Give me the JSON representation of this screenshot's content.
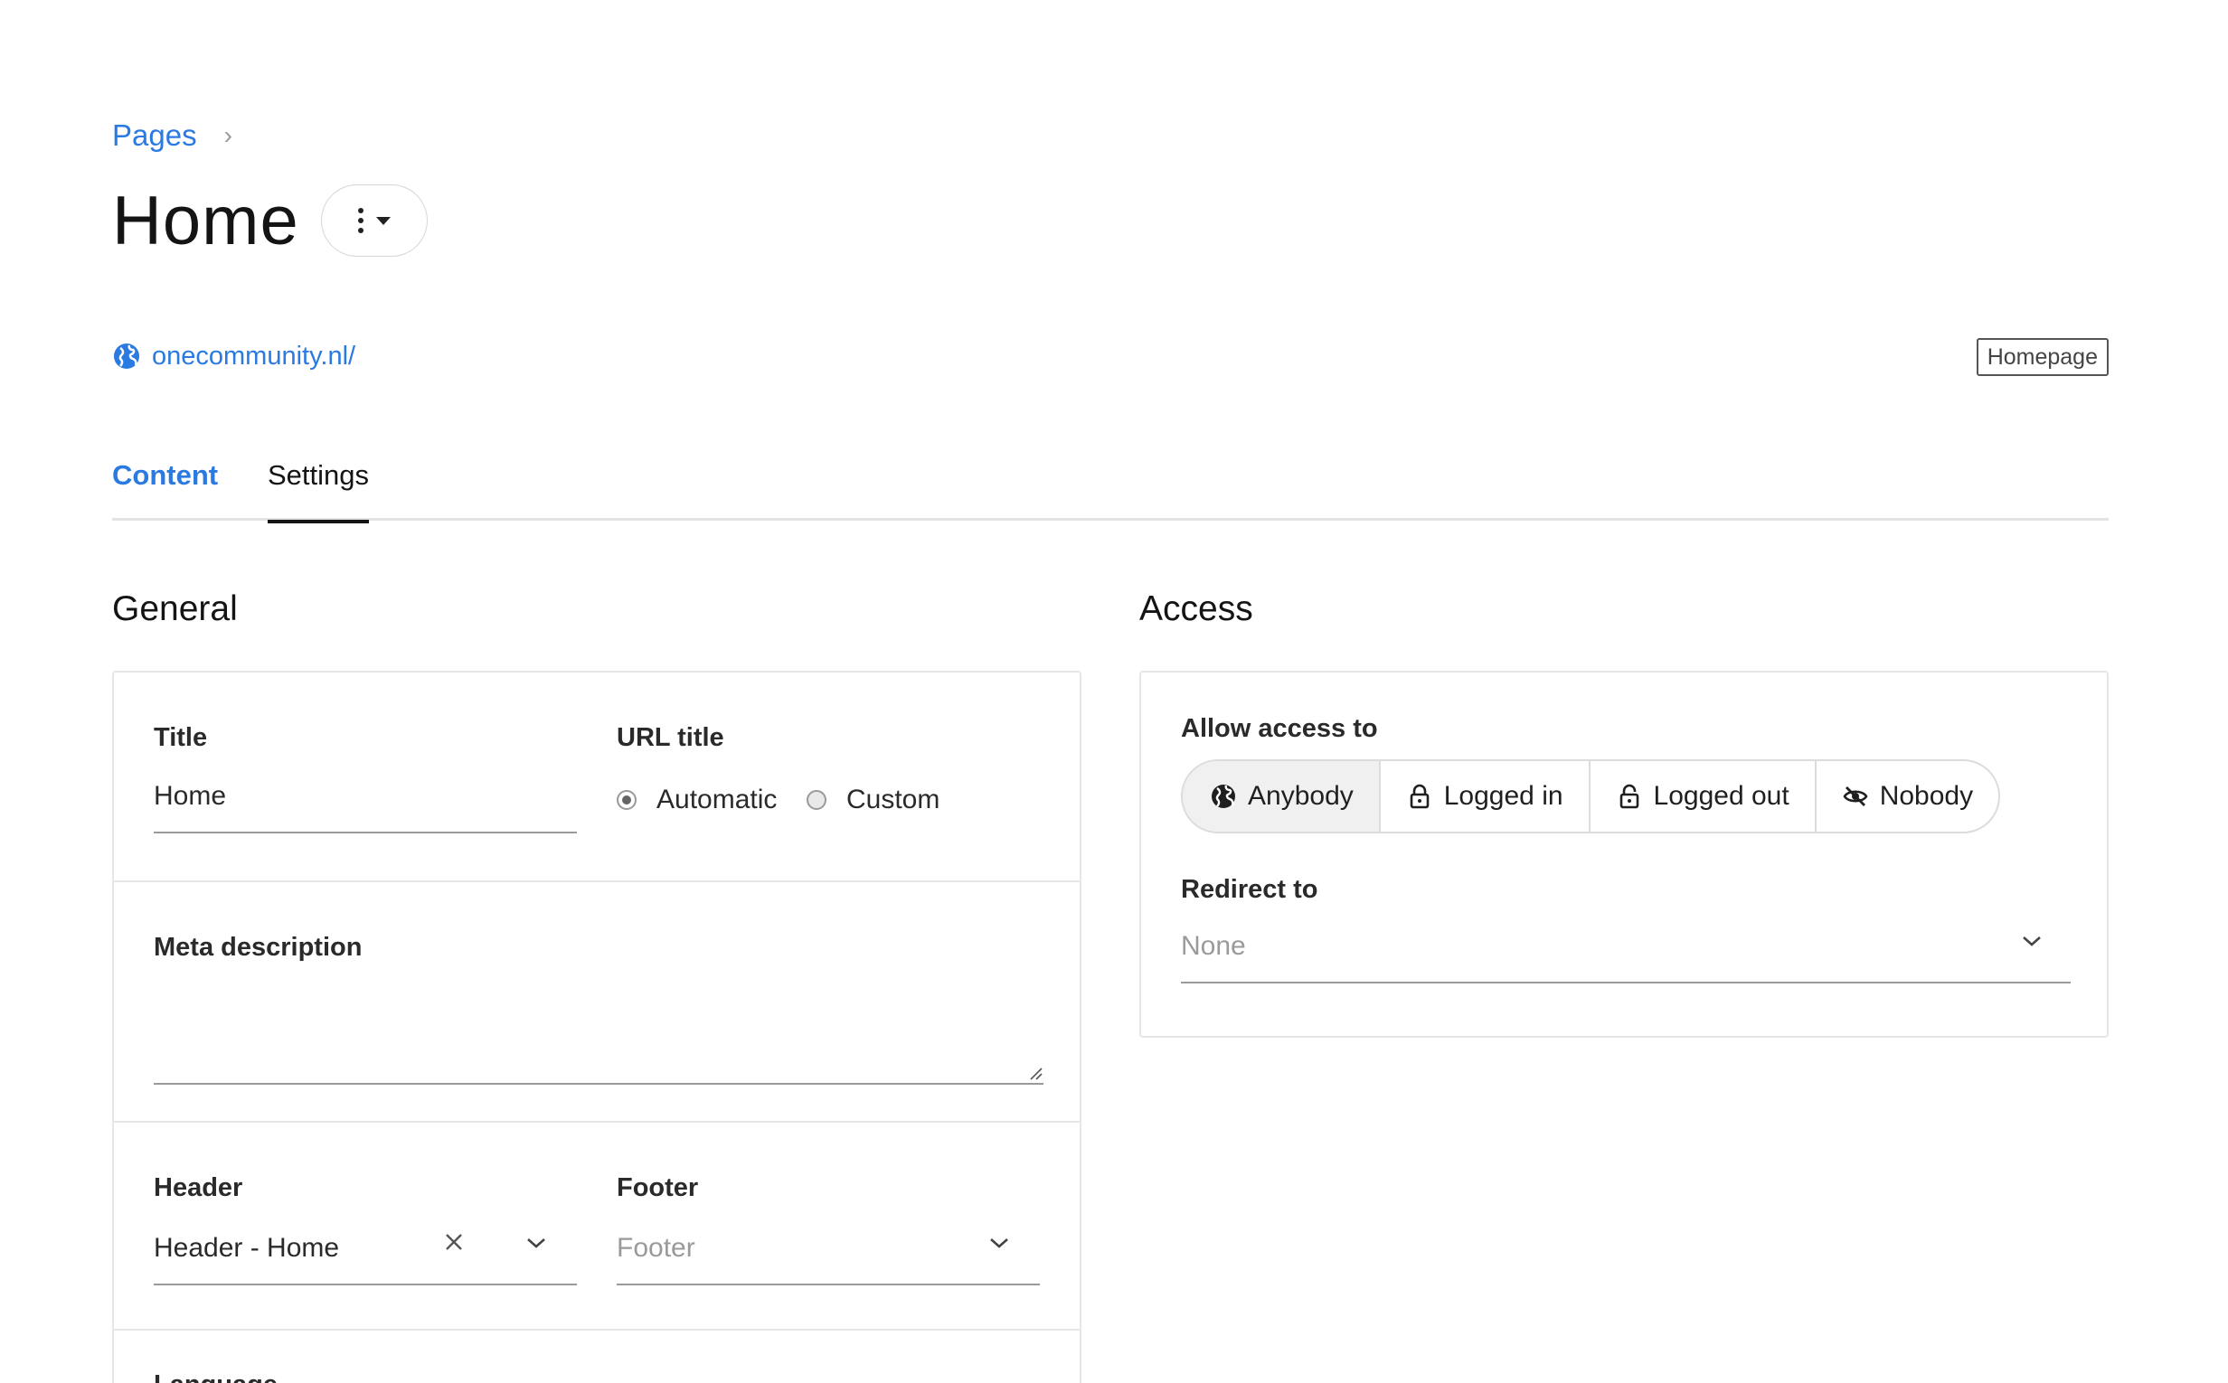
{
  "breadcrumb": {
    "parent": "Pages",
    "separator": "›"
  },
  "page": {
    "title": "Home"
  },
  "url": {
    "text": "onecommunity.nl/"
  },
  "badge": {
    "label": "Homepage"
  },
  "tabs": [
    {
      "label": "Content"
    },
    {
      "label": "Settings"
    }
  ],
  "general": {
    "heading": "General",
    "title_label": "Title",
    "title_value": "Home",
    "url_title_label": "URL title",
    "url_options": [
      {
        "label": "Automatic",
        "checked": true
      },
      {
        "label": "Custom",
        "checked": false
      }
    ],
    "meta_label": "Meta description",
    "header_label": "Header",
    "header_value": "Header - Home",
    "footer_label": "Footer",
    "footer_placeholder": "Footer",
    "language_label": "Language"
  },
  "access": {
    "heading": "Access",
    "allow_label": "Allow access to",
    "options": [
      {
        "label": "Anybody",
        "icon": "globe-icon",
        "selected": true
      },
      {
        "label": "Logged in",
        "icon": "lock-icon",
        "selected": false
      },
      {
        "label": "Logged out",
        "icon": "unlock-icon",
        "selected": false
      },
      {
        "label": "Nobody",
        "icon": "eye-slash-icon",
        "selected": false
      }
    ],
    "redirect_label": "Redirect to",
    "redirect_placeholder": "None"
  },
  "colors": {
    "accent": "#2a7ae2",
    "text": "#1f1f1f",
    "border": "#e6e6e6"
  }
}
